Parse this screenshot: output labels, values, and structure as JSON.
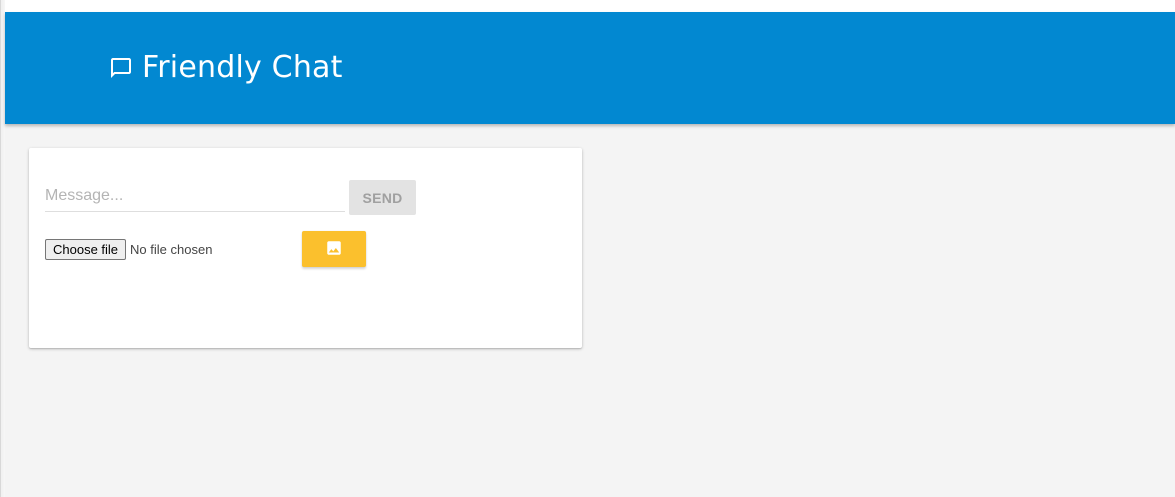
{
  "app": {
    "title": "Friendly Chat",
    "brand_icon": "chat-bubble-outline-icon",
    "header_color": "#0288d1"
  },
  "composer": {
    "message_placeholder": "Message...",
    "message_value": "",
    "send_label": "SEND",
    "choose_file_label": "Choose file",
    "file_status": "No file chosen",
    "image_button_icon": "image-icon",
    "image_button_color": "#fbc02d"
  }
}
